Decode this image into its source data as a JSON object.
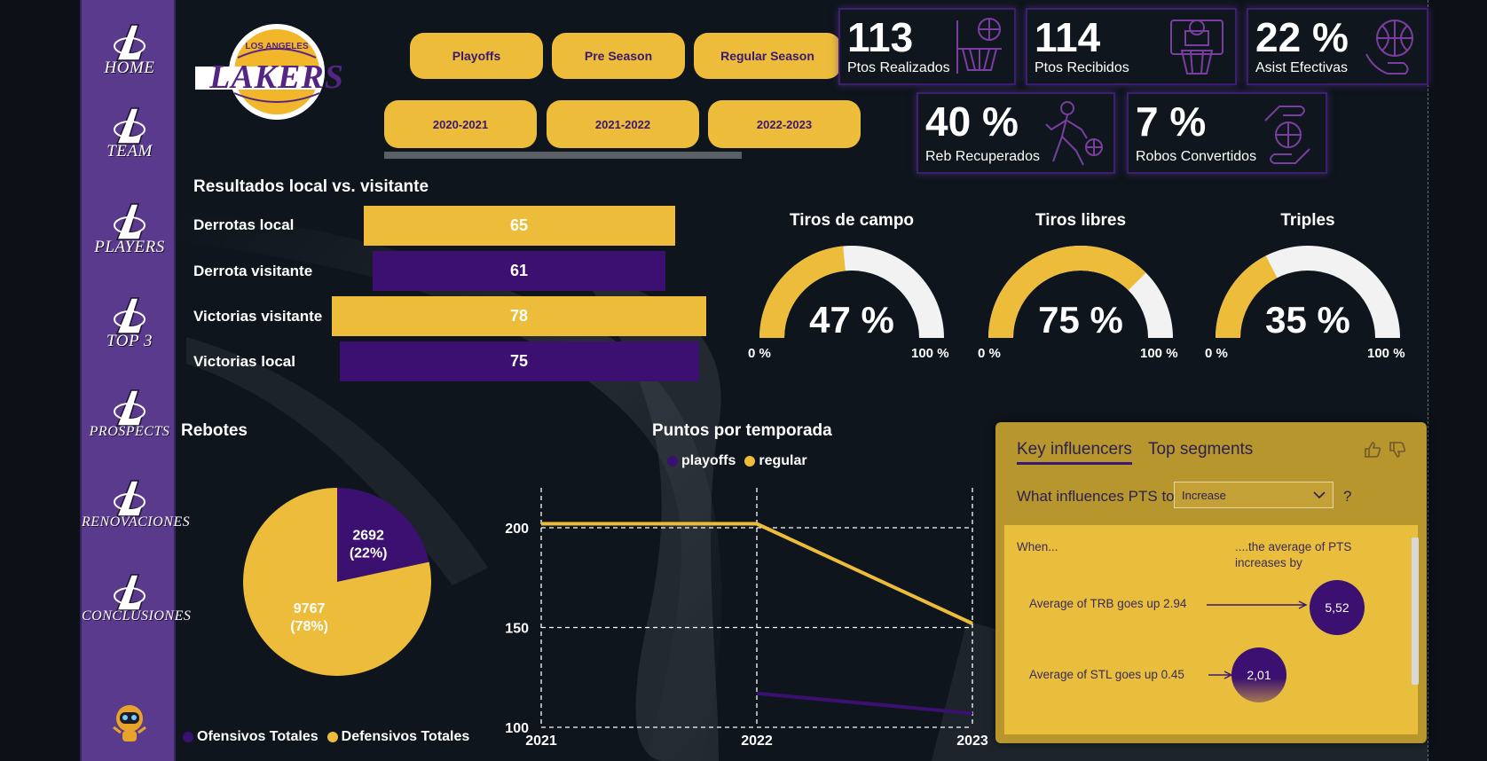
{
  "nav": {
    "items": [
      {
        "label": "HOME"
      },
      {
        "label": "TEAM"
      },
      {
        "label": "PLAYERS"
      },
      {
        "label": "TOP 3"
      },
      {
        "label": "PROSPECTS"
      },
      {
        "label": "RENOVACIONES"
      },
      {
        "label": "CONCLUSIONES"
      }
    ]
  },
  "brand": {
    "top": "LOS ANGELES",
    "name": "LAKERS"
  },
  "slicers": {
    "season_type": [
      "Playoffs",
      "Pre Season",
      "Regular Season"
    ],
    "season_year": [
      "2020-2021",
      "2021-2022",
      "2022-2023"
    ]
  },
  "kpis": [
    {
      "value": "113",
      "label": "Ptos Realizados",
      "icon": "basketball-hoop-icon"
    },
    {
      "value": "114",
      "label": "Ptos Recibidos",
      "icon": "backboard-icon"
    },
    {
      "value": "22 %",
      "label": "Asist Efectivas",
      "icon": "ball-hand-icon"
    },
    {
      "value": "40 %",
      "label": "Reb Recuperados",
      "icon": "player-dribble-icon"
    },
    {
      "value": "7 %",
      "label": "Robos Convertidos",
      "icon": "ball-exchange-icon"
    }
  ],
  "results": {
    "title": "Resultados local vs. visitante",
    "rows": [
      {
        "label": "Derrotas local",
        "value": 65
      },
      {
        "label": "Derrota visitante",
        "value": 61
      },
      {
        "label": "Victorias visitante",
        "value": 78
      },
      {
        "label": "Victorias local",
        "value": 75
      }
    ]
  },
  "gauges": [
    {
      "title": "Tiros de campo",
      "value": "47 %",
      "fraction": 0.47,
      "min": "0 %",
      "max": "100 %"
    },
    {
      "title": "Tiros libres",
      "value": "75 %",
      "fraction": 0.75,
      "min": "0 %",
      "max": "100 %"
    },
    {
      "title": "Triples",
      "value": "35 %",
      "fraction": 0.35,
      "min": "0 %",
      "max": "100 %"
    }
  ],
  "rebotes": {
    "title": "Rebotes",
    "legend": [
      "Ofensivos Totales",
      "Defensivos Totales"
    ]
  },
  "puntos": {
    "title": "Puntos por temporada",
    "legend": [
      "playoffs",
      "regular"
    ]
  },
  "chart_data": [
    {
      "type": "bar",
      "title": "Resultados local vs. visitante",
      "categories": [
        "Derrotas local",
        "Derrota visitante",
        "Victorias visitante",
        "Victorias local"
      ],
      "values": [
        65,
        61,
        78,
        75
      ]
    },
    {
      "type": "pie",
      "title": "Rebotes",
      "labels": [
        "Ofensivos Totales",
        "Defensivos Totales"
      ],
      "values": [
        2692,
        9767
      ],
      "percent": [
        "22%",
        "78%"
      ],
      "slice_labels": [
        [
          "2692",
          "(22%)"
        ],
        [
          "9767",
          "(78%)"
        ]
      ],
      "colors": [
        "#3b1070",
        "#ecbc3a"
      ]
    },
    {
      "type": "line",
      "title": "Puntos por temporada",
      "x": [
        2021,
        2022,
        2023
      ],
      "ylim": [
        100,
        220
      ],
      "yticks": [
        100,
        150,
        200
      ],
      "series": [
        {
          "name": "playoffs",
          "values": [
            null,
            117,
            107
          ],
          "color": "#3b1070"
        },
        {
          "name": "regular",
          "values": [
            202,
            202,
            152
          ],
          "color": "#ecbc3a"
        }
      ]
    }
  ],
  "influencers": {
    "tabs": [
      "Key influencers",
      "Top segments"
    ],
    "question": "What influences PTS to",
    "selected": "Increase",
    "q_mark": "?",
    "col_when": "When...",
    "col_avg": "....the average of PTS increases by",
    "rows": [
      {
        "label": "Average of TRB goes up 2.94",
        "value": "5,52"
      },
      {
        "label": "Average of STL goes up 0.45",
        "value": "2,01"
      }
    ]
  }
}
